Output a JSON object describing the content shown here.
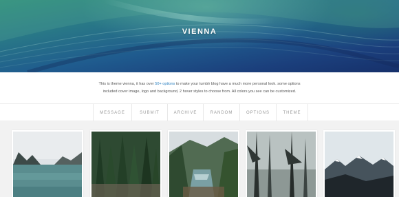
{
  "header": {
    "title": "VIENNA"
  },
  "description": {
    "text_before": "This is theme vienna, it has over ",
    "link": "50+ options",
    "text_after": " to make your tumblr blog have a much more personal look. some options",
    "line2": "included cover image, logo and background, 2 hover styles to choose from. All colors you see can be customized."
  },
  "nav": {
    "items": [
      {
        "label": "Message"
      },
      {
        "label": "Submit"
      },
      {
        "label": "Archive"
      },
      {
        "label": "Random"
      },
      {
        "label": "Options"
      },
      {
        "label": "Theme"
      }
    ]
  },
  "colors": {
    "accent_link": "#2a7fbf",
    "nav_text": "#9a9a9a",
    "grid_background": "#f2f2f2"
  },
  "posts": [
    {
      "kind": "photo",
      "subject": "mountain-lake-icon"
    },
    {
      "kind": "photo",
      "subject": "pine-forest-icon"
    },
    {
      "kind": "photo",
      "subject": "forest-stream-icon"
    },
    {
      "kind": "photo",
      "subject": "misty-trees-icon"
    },
    {
      "kind": "photo",
      "subject": "snowy-mountains-icon"
    }
  ]
}
